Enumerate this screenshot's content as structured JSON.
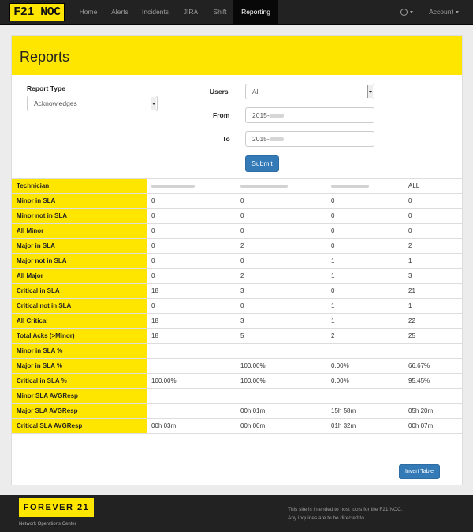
{
  "navbar": {
    "brand": "F21 NOC",
    "items": [
      "Home",
      "Alerts",
      "Incidents",
      "JIRA",
      "Shift",
      "Reporting"
    ],
    "active": "Reporting",
    "account_label": "Account"
  },
  "page": {
    "title": "Reports"
  },
  "form": {
    "report_type_label": "Report Type",
    "report_type_value": "Acknowledges",
    "users_label": "Users",
    "users_value": "All",
    "from_label": "From",
    "from_value": "2015-",
    "to_label": "To",
    "to_value": "2015-",
    "submit_label": "Submit"
  },
  "table": {
    "header_label": "Technician",
    "columns": [
      "",
      "",
      "",
      "ALL"
    ],
    "rows": [
      {
        "label": "Minor in SLA",
        "values": [
          "0",
          "0",
          "0",
          "0"
        ]
      },
      {
        "label": "Minor not in SLA",
        "values": [
          "0",
          "0",
          "0",
          "0"
        ]
      },
      {
        "label": "All Minor",
        "values": [
          "0",
          "0",
          "0",
          "0"
        ]
      },
      {
        "label": "Major in SLA",
        "values": [
          "0",
          "2",
          "0",
          "2"
        ]
      },
      {
        "label": "Major not in SLA",
        "values": [
          "0",
          "0",
          "1",
          "1"
        ]
      },
      {
        "label": "All Major",
        "values": [
          "0",
          "2",
          "1",
          "3"
        ]
      },
      {
        "label": "Critical in SLA",
        "values": [
          "18",
          "3",
          "0",
          "21"
        ]
      },
      {
        "label": "Critical not in SLA",
        "values": [
          "0",
          "0",
          "1",
          "1"
        ]
      },
      {
        "label": "All Critical",
        "values": [
          "18",
          "3",
          "1",
          "22"
        ]
      },
      {
        "label": "Total Acks (>Minor)",
        "values": [
          "18",
          "5",
          "2",
          "25"
        ]
      },
      {
        "label": "Minor in SLA %",
        "values": [
          "",
          "",
          "",
          ""
        ]
      },
      {
        "label": "Major in SLA %",
        "values": [
          "",
          "100.00%",
          "0.00%",
          "66.67%"
        ]
      },
      {
        "label": "Critical in SLA %",
        "values": [
          "100.00%",
          "100.00%",
          "0.00%",
          "95.45%"
        ]
      },
      {
        "label": "Minor SLA AVGResp",
        "values": [
          "",
          "",
          "",
          ""
        ]
      },
      {
        "label": "Major SLA AVGResp",
        "values": [
          "",
          "00h 01m",
          "15h 58m",
          "05h 20m"
        ]
      },
      {
        "label": "Critical SLA AVGResp",
        "values": [
          "00h 03m",
          "00h 00m",
          "01h 32m",
          "00h 07m"
        ]
      }
    ]
  },
  "invert_label": "Invert Table",
  "footer": {
    "logo": "FOREVER 21",
    "logo_mark": "®",
    "subtitle": "Network Operations Center",
    "note_line1": "This site is intended to host tools for the F21 NOC.",
    "note_line2": "Any inquiries are to be directed to"
  }
}
